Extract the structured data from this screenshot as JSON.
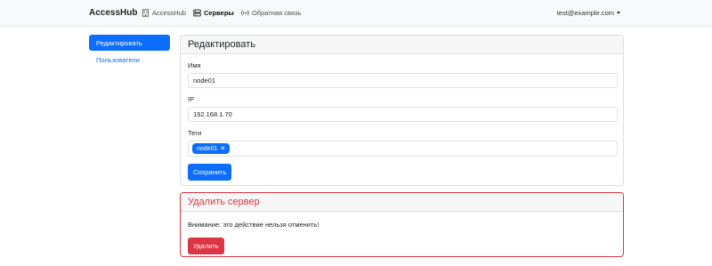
{
  "navbar": {
    "brand": "AccessHub",
    "links": [
      {
        "label": "AccessHub",
        "icon": "building-icon",
        "active": false
      },
      {
        "label": "Серверы",
        "icon": "server-icon",
        "active": true
      },
      {
        "label": "Обратная связь",
        "icon": "broadcast-icon",
        "active": false
      }
    ],
    "user_email": "test@example.com"
  },
  "sidebar": {
    "items": [
      {
        "label": "Редактировать",
        "active": true
      },
      {
        "label": "Пользователи",
        "active": false
      }
    ]
  },
  "edit_card": {
    "title": "Редактировать",
    "name_label": "Имя",
    "name_value": "node01",
    "ip_label": "IP",
    "ip_value": "192.168.1.70",
    "tags_label": "Теги",
    "tags": [
      {
        "label": "node01",
        "remove": "✕"
      }
    ],
    "save_label": "Сохранить"
  },
  "delete_card": {
    "title": "Удалить сервер",
    "warning": "Внимание: это действие нельзя отменить!",
    "delete_label": "Удалить"
  },
  "colors": {
    "primary": "#0d6efd",
    "danger": "#dc3545",
    "navbar_bg": "#f8f9fa"
  }
}
